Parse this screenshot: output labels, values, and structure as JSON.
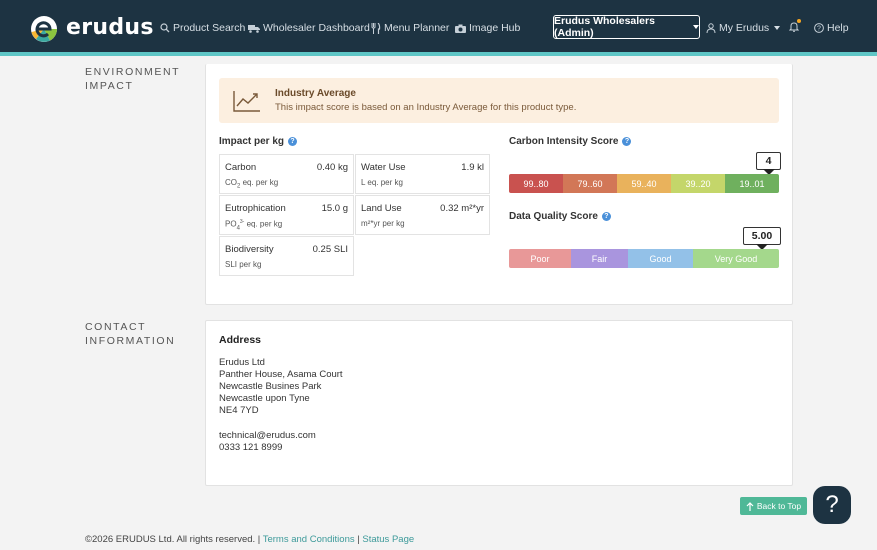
{
  "nav": {
    "logo_text": "erudus",
    "links": [
      {
        "label": "Product Search",
        "icon": "search-icon"
      },
      {
        "label": "Wholesaler Dashboard",
        "icon": "truck-icon"
      },
      {
        "label": "Menu Planner",
        "icon": "cutlery-icon"
      },
      {
        "label": "Image Hub",
        "icon": "camera-icon"
      }
    ],
    "org_selector": "Erudus Wholesalers (Admin)",
    "account_label": "My Erudus",
    "help_label": "Help"
  },
  "environment": {
    "section_label": "Environment Impact",
    "banner": {
      "title": "Industry Average",
      "text": "This impact score is based on an Industry Average for this product type."
    },
    "impact_heading": "Impact per kg",
    "impacts": [
      {
        "name": "Carbon",
        "value": "0.40 kg",
        "unit_prefix": "CO",
        "unit_sub": "2",
        "unit_rest": " eq. per kg"
      },
      {
        "name": "Water Use",
        "value": "1.9 kl",
        "unit_prefix": "L eq. per kg",
        "unit_sub": "",
        "unit_rest": ""
      },
      {
        "name": "Eutrophication",
        "value": "15.0 g",
        "unit_prefix": "PO",
        "unit_sub": "4",
        "unit_sup": "3-",
        "unit_rest": " eq. per kg"
      },
      {
        "name": "Land Use",
        "value": "0.32 m²*yr",
        "unit_prefix": "m²*yr per kg",
        "unit_sub": "",
        "unit_rest": ""
      },
      {
        "name": "Biodiversity",
        "value": "0.25 SLI",
        "unit_prefix": "SLI per kg",
        "unit_sub": "",
        "unit_rest": ""
      }
    ],
    "carbon_score": {
      "heading": "Carbon Intensity Score",
      "value": "4",
      "selected_index": 4,
      "segments": [
        {
          "label": "99..80",
          "color": "#c9524f"
        },
        {
          "label": "79..60",
          "color": "#d27757"
        },
        {
          "label": "59..40",
          "color": "#e9b25c"
        },
        {
          "label": "39..20",
          "color": "#c4d66a"
        },
        {
          "label": "19..01",
          "color": "#6fb05e"
        }
      ]
    },
    "quality_score": {
      "heading": "Data Quality Score",
      "value": "5.00",
      "selected_index": 3,
      "segments": [
        {
          "label": "Poor",
          "color": "#e89898"
        },
        {
          "label": "Fair",
          "color": "#a995de"
        },
        {
          "label": "Good",
          "color": "#93c1e8"
        },
        {
          "label": "Very Good",
          "color": "#a4d88c"
        }
      ]
    }
  },
  "contact": {
    "section_label": "Contact Information",
    "address_heading": "Address",
    "lines": [
      "Erudus Ltd",
      "Panther House, Asama Court",
      "Newcastle Busines Park",
      "Newcastle upon Tyne",
      "NE4 7YD",
      "",
      "technical@erudus.com",
      "0333 121 8999"
    ]
  },
  "back_to_top": "Back to Top",
  "help_fab": "?",
  "footer": {
    "copyright": "©2026 ERUDUS Ltd. All rights reserved.",
    "separator": "|",
    "terms": "Terms and Conditions",
    "status": "Status Page"
  }
}
